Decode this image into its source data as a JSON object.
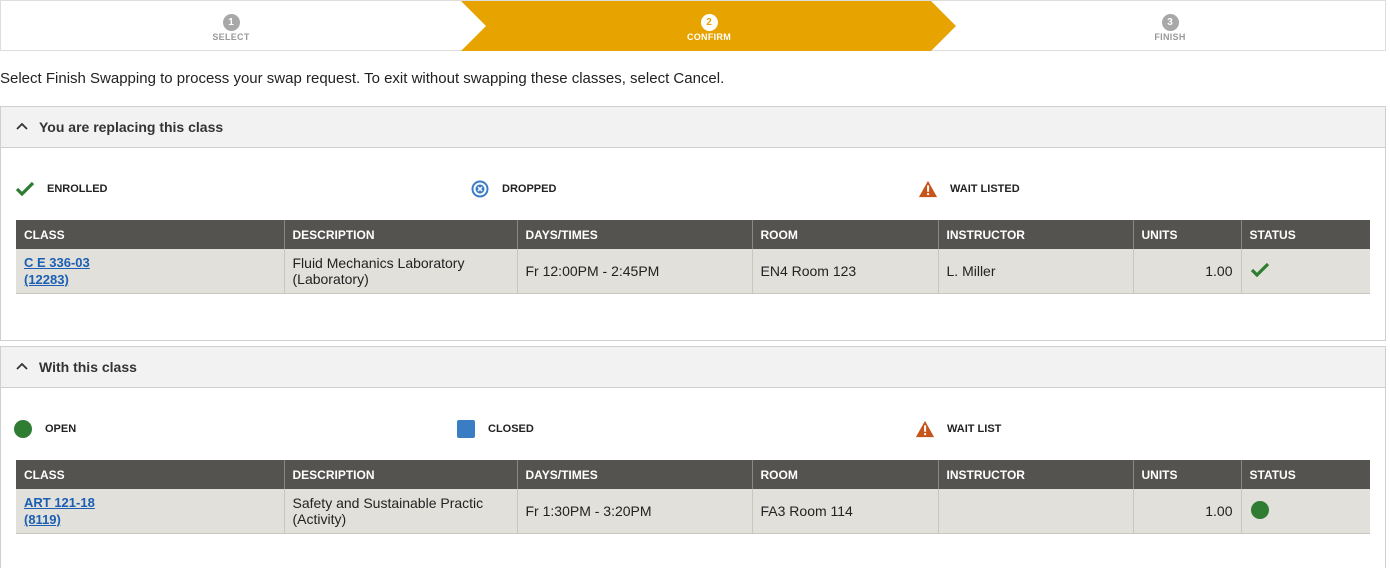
{
  "stepper": {
    "steps": [
      {
        "num": "1",
        "label": "SELECT"
      },
      {
        "num": "2",
        "label": "CONFIRM"
      },
      {
        "num": "3",
        "label": "FINISH"
      }
    ],
    "active_color": "#e7a300"
  },
  "instructions": "Select Finish Swapping to process your swap request. To exit without swapping these classes, select Cancel.",
  "replacing": {
    "title": "You are replacing this class",
    "legend": [
      {
        "icon": "checkmark-icon",
        "label": "ENROLLED"
      },
      {
        "icon": "dropped-circle-x-icon",
        "label": "DROPPED"
      },
      {
        "icon": "warning-triangle-icon",
        "label": "WAIT LISTED"
      }
    ],
    "columns": [
      "CLASS",
      "DESCRIPTION",
      "DAYS/TIMES",
      "ROOM",
      "INSTRUCTOR",
      "UNITS",
      "STATUS"
    ],
    "row": {
      "class_line1": "C E 336-03",
      "class_line2": "(12283)",
      "description_line1": "Fluid Mechanics Laboratory",
      "description_line2": "(Laboratory)",
      "days_times": "Fr 12:00PM - 2:45PM",
      "room": "EN4  Room 123",
      "instructor": "L. Miller",
      "units": "1.00",
      "status_icon": "enrolled-check-icon"
    }
  },
  "with_class": {
    "title": "With this class",
    "legend": [
      {
        "icon": "open-circle-icon",
        "label": "OPEN"
      },
      {
        "icon": "closed-square-icon",
        "label": "CLOSED"
      },
      {
        "icon": "warning-triangle-icon",
        "label": "WAIT LIST"
      }
    ],
    "columns": [
      "CLASS",
      "DESCRIPTION",
      "DAYS/TIMES",
      "ROOM",
      "INSTRUCTOR",
      "UNITS",
      "STATUS"
    ],
    "row": {
      "class_line1": "ART 121-18",
      "class_line2": "(8119)",
      "description_line1": "Safety and Sustainable Practic",
      "description_line2": "(Activity)",
      "days_times": "Fr 1:30PM - 3:20PM",
      "room": "FA3  Room 114",
      "instructor": "",
      "units": "1.00",
      "status_icon": "open-circle-icon"
    }
  },
  "colors": {
    "green": "#2e7d32",
    "blue": "#3b7dc4",
    "warning": "#c7541a",
    "header_bg": "#555350",
    "row_bg": "#e2e0da"
  }
}
